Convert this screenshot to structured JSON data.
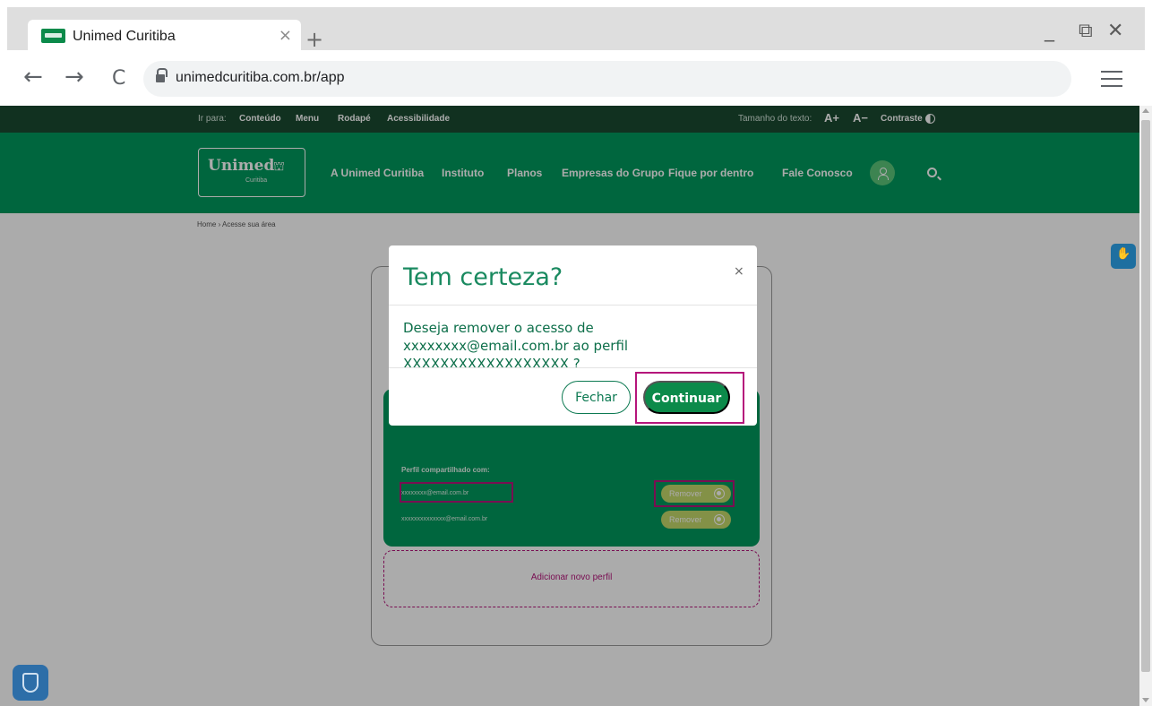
{
  "browser": {
    "tab_title": "Unimed Curitiba",
    "tab_close": "×",
    "new_tab": "+",
    "url": "unimedcuritiba.com.br/app",
    "window_min": "_",
    "window_max": "⧉",
    "window_close": "✕",
    "back": "←",
    "forward": "→",
    "reload": "C"
  },
  "utility_bar": {
    "goto_label": "Ir para:",
    "links": [
      "Conteúdo",
      "Menu",
      "Rodapé",
      "Acessibilidade"
    ],
    "text_size_label": "Tamanho do texto:",
    "increase": "A+",
    "decrease": "A−",
    "contrast": "Contraste"
  },
  "main_nav": {
    "logo_text": "Unimed",
    "logo_sub": "Curitiba",
    "logo_mark": "⛫",
    "items": [
      "A Unimed Curitiba",
      "Instituto",
      "Planos",
      "Empresas do Grupo",
      "Fique por dentro",
      "Fale Conosco"
    ]
  },
  "breadcrumb": "Home › Acesse sua área",
  "shared_profiles": {
    "label": "Perfil compartilhado com:",
    "emails": [
      "xxxxxxxx@email.com.br",
      "xxxxxxxxxxxxxx@email.com.br"
    ],
    "remove_label": "Remover",
    "add_profile": "Adicionar novo perfil"
  },
  "modal": {
    "title": "Tem certeza?",
    "close": "×",
    "body": "Deseja remover o acesso de xxxxxxxx@email.com.br ao perfil XXXXXXXXXXXXXXXXXX ?",
    "close_button": "Fechar",
    "continue_button": "Continuar"
  },
  "colors": {
    "brand_green": "#00995d",
    "dark_green": "#1a4a31",
    "highlight": "#b5157b"
  }
}
